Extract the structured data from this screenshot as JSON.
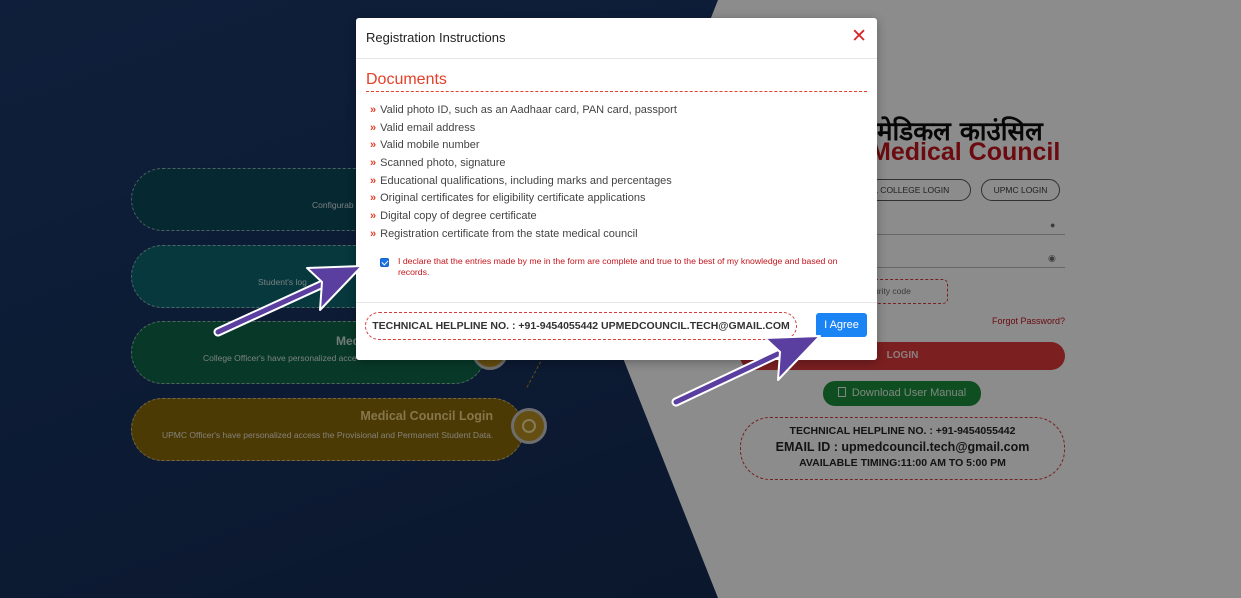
{
  "colors": {
    "accent_red": "#e3402a",
    "brand_red": "#c4151c",
    "primary_blue": "#1a84f5",
    "arrow_purple": "#5a3ea0"
  },
  "background": {
    "pills": [
      {
        "title": "",
        "desc": "Configurab"
      },
      {
        "title": "",
        "desc": "Student's log"
      },
      {
        "title": "Med",
        "desc": "College Officer's have personalized acce"
      },
      {
        "title": "Medical Council Login",
        "desc": "UPMC Officer's have personalized access the Provisional and Permanent Student Data."
      }
    ],
    "pill_icon": "shield-icon"
  },
  "login_panel": {
    "hindi_title": "मेडिकल काउंसिल",
    "english_title": "Medical Council",
    "tabs": [
      "CAL COLLEGE LOGIN",
      "UPMC LOGIN"
    ],
    "username_icon": "user-icon",
    "password_icon": "eye-icon",
    "security_placeholder": "urity code",
    "forgot_password": "Forgot Password?",
    "login_button": "LOGIN",
    "manual_button": "Download User Manual",
    "helpline": {
      "line1": "TECHNICAL HELPLINE NO. : +91-9454055442",
      "line2": "EMAIL ID : upmedcouncil.tech@gmail.com",
      "line3": "AVAILABLE TIMING:11:00 AM TO 5:00 PM"
    }
  },
  "modal": {
    "title": "Registration Instructions",
    "close_label": "✕",
    "section_title": "Documents",
    "documents": [
      "Valid photo ID, such as an Aadhaar card, PAN card, passport",
      "Valid email address",
      "Valid mobile number",
      "Scanned photo, signature",
      "Educational qualifications, including marks and percentages",
      "Original certificates for eligibility certificate applications",
      "Digital copy of degree certificate",
      "Registration certificate from the state medical council"
    ],
    "declaration_checked": true,
    "declaration": "I declare that the entries made by me in the form are complete and true to the best of my knowledge and based on records.",
    "footer_helpline": "TECHNICAL HELPLINE NO. : +91-9454055442 UPMEDCOUNCIL.TECH@GMAIL.COM",
    "agree_button": "I Agree"
  }
}
